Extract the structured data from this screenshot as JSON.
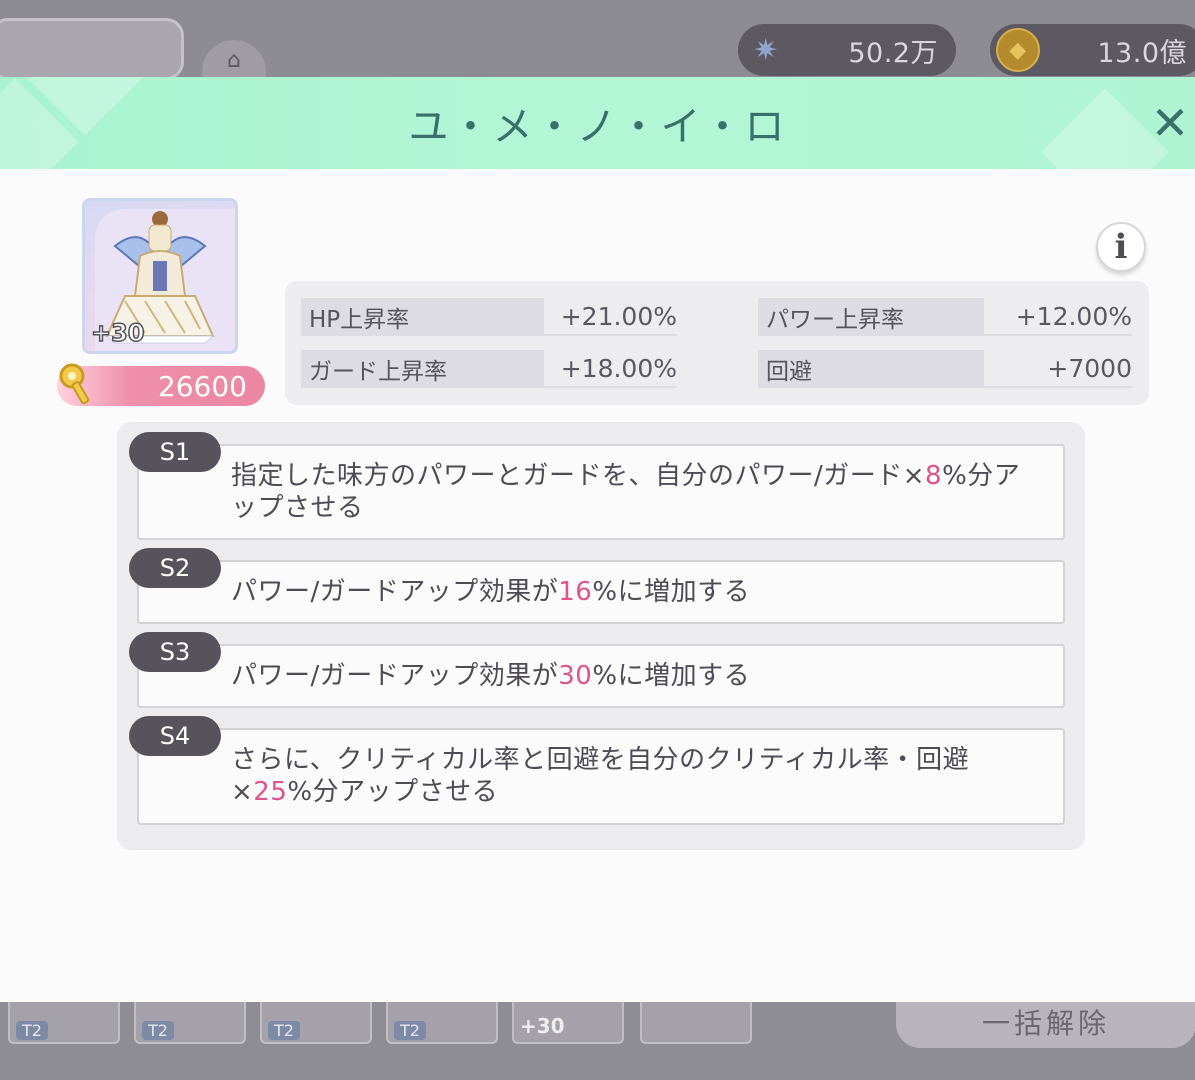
{
  "background": {
    "currencies": [
      {
        "icon": "star-crystal-icon",
        "value": "50.2万"
      },
      {
        "icon": "gold-coin-icon",
        "value": "13.0億"
      }
    ],
    "thumbnails": [
      {
        "tier": "T2"
      },
      {
        "tier": "T2"
      },
      {
        "tier": "T2"
      },
      {
        "tier": "T2"
      },
      {
        "plus": "+30"
      },
      {
        "tier": ""
      }
    ],
    "bottom_button_label": "一括解除"
  },
  "modal": {
    "title": "ユ・メ・ノ・イ・ロ",
    "close_label": "✕",
    "info_label": "i",
    "card": {
      "plus": "+30"
    },
    "price": "26600",
    "stats": [
      {
        "label": "HP上昇率",
        "value": "+21.00%"
      },
      {
        "label": "パワー上昇率",
        "value": "+12.00%"
      },
      {
        "label": "ガード上昇率",
        "value": "+18.00%"
      },
      {
        "label": "回避",
        "value": "+7000"
      }
    ],
    "skills": [
      {
        "tag": "S1",
        "pre": "指定した味方のパワーとガードを、自分のパワー/ガード×",
        "highlight": "8",
        "post": "%分アップさせる"
      },
      {
        "tag": "S2",
        "pre": "パワー/ガードアップ効果が",
        "highlight": "16",
        "post": "%に増加する"
      },
      {
        "tag": "S3",
        "pre": "パワー/ガードアップ効果が",
        "highlight": "30",
        "post": "%に増加する"
      },
      {
        "tag": "S4",
        "pre": "さらに、クリティカル率と回避を自分のクリティカル率・回避×",
        "highlight": "25",
        "post": "%分アップさせる"
      }
    ]
  },
  "colors": {
    "header": "#b3f6d6",
    "title_text": "#38706a",
    "highlight": "#e0538a",
    "skill_tag": "#56535c",
    "price_pill": "#ec87a4"
  }
}
